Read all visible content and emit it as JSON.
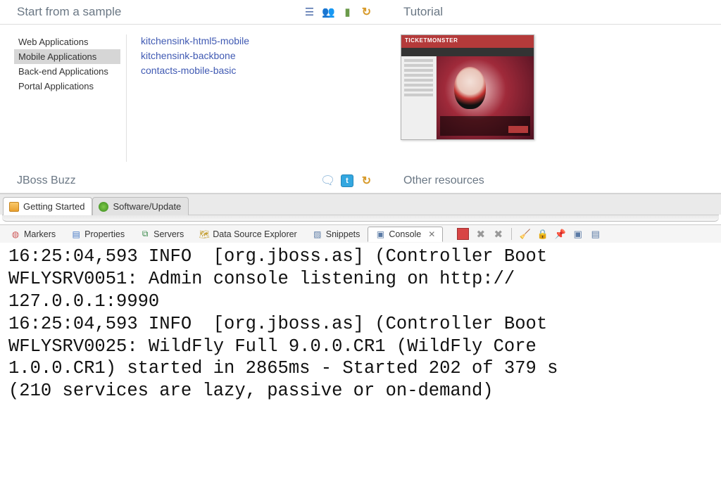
{
  "sample": {
    "title": "Start from a sample",
    "categories": [
      {
        "label": "Web Applications",
        "selected": false
      },
      {
        "label": "Mobile Applications",
        "selected": true
      },
      {
        "label": "Back-end Applications",
        "selected": false
      },
      {
        "label": "Portal Applications",
        "selected": false
      }
    ],
    "samples": [
      "kitchensink-html5-mobile",
      "kitchensink-backbone",
      "contacts-mobile-basic"
    ]
  },
  "tutorial": {
    "title": "Tutorial",
    "thumb_label": "TICKETMONSTER"
  },
  "buzz": {
    "title": "JBoss Buzz"
  },
  "other": {
    "title": "Other resources"
  },
  "editor_tabs": [
    {
      "label": "Getting Started",
      "active": true
    },
    {
      "label": "Software/Update",
      "active": false
    }
  ],
  "views": [
    {
      "label": "Markers"
    },
    {
      "label": "Properties"
    },
    {
      "label": "Servers"
    },
    {
      "label": "Data Source Explorer"
    },
    {
      "label": "Snippets"
    },
    {
      "label": "Console",
      "active": true
    }
  ],
  "console_text": "16:25:04,593 INFO  [org.jboss.as] (Controller Boot\nWFLYSRV0051: Admin console listening on http://\n127.0.0.1:9990\n16:25:04,593 INFO  [org.jboss.as] (Controller Boot\nWFLYSRV0025: WildFly Full 9.0.0.CR1 (WildFly Core\n1.0.0.CR1) started in 2865ms - Started 202 of 379 s\n(210 services are lazy, passive or on-demand)"
}
